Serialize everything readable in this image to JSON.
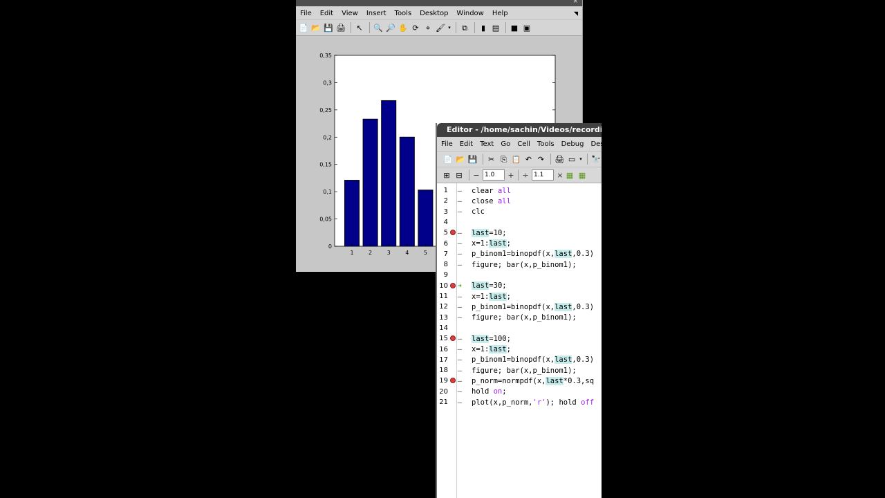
{
  "figure": {
    "menu": [
      "File",
      "Edit",
      "View",
      "Insert",
      "Tools",
      "Desktop",
      "Window",
      "Help"
    ],
    "toolbar_icons": [
      "new-file-icon",
      "open-folder-icon",
      "save-icon",
      "print-icon",
      "pointer-icon",
      "zoom-in-icon",
      "zoom-out-icon",
      "pan-hand-icon",
      "rotate-3d-icon",
      "data-cursor-icon",
      "brush-icon",
      "link-plot-icon",
      "colorbar-icon",
      "legend-icon",
      "hide-plot-tools-icon",
      "show-plot-tools-icon"
    ],
    "chart_data": {
      "type": "bar",
      "categories": [
        "1",
        "2",
        "3",
        "4",
        "5"
      ],
      "values": [
        0.121,
        0.233,
        0.267,
        0.2,
        0.103
      ],
      "ylim": [
        0,
        0.35
      ],
      "yticks": [
        "0",
        "0,05",
        "0,1",
        "0,15",
        "0,2",
        "0,25",
        "0,3",
        "0,35"
      ],
      "bar_color": "#00008b"
    }
  },
  "editor": {
    "title": "Editor - /home/sachin/Videos/recordi",
    "menu": [
      "File",
      "Edit",
      "Text",
      "Go",
      "Cell",
      "Tools",
      "Debug",
      "Desk"
    ],
    "spacing_value": "1.0",
    "scale_value": "1.1",
    "lines": [
      {
        "n": "1",
        "bp": false,
        "arrow": false,
        "tokens": [
          {
            "t": "clear "
          },
          {
            "t": "all",
            "c": "kw"
          }
        ]
      },
      {
        "n": "2",
        "bp": false,
        "arrow": false,
        "tokens": [
          {
            "t": "close "
          },
          {
            "t": "all",
            "c": "kw"
          }
        ]
      },
      {
        "n": "3",
        "bp": false,
        "arrow": false,
        "tokens": [
          {
            "t": "clc"
          }
        ]
      },
      {
        "n": "4",
        "bp": false,
        "arrow": false,
        "tokens": []
      },
      {
        "n": "5",
        "bp": true,
        "arrow": false,
        "tokens": [
          {
            "t": "last",
            "c": "hl"
          },
          {
            "t": "=10;"
          }
        ]
      },
      {
        "n": "6",
        "bp": false,
        "arrow": false,
        "tokens": [
          {
            "t": "x=1:"
          },
          {
            "t": "last",
            "c": "hl"
          },
          {
            "t": ";"
          }
        ]
      },
      {
        "n": "7",
        "bp": false,
        "arrow": false,
        "tokens": [
          {
            "t": "p_binom1=binopdf(x,"
          },
          {
            "t": "last",
            "c": "hl"
          },
          {
            "t": ",0.3)"
          }
        ]
      },
      {
        "n": "8",
        "bp": false,
        "arrow": false,
        "tokens": [
          {
            "t": "figure; bar(x,p_binom1);"
          }
        ]
      },
      {
        "n": "9",
        "bp": false,
        "arrow": false,
        "tokens": []
      },
      {
        "n": "10",
        "bp": true,
        "arrow": true,
        "tokens": [
          {
            "t": "last",
            "c": "hl"
          },
          {
            "t": "=30;"
          }
        ]
      },
      {
        "n": "11",
        "bp": false,
        "arrow": false,
        "tokens": [
          {
            "t": "x=1:"
          },
          {
            "t": "last",
            "c": "hl"
          },
          {
            "t": ";"
          }
        ]
      },
      {
        "n": "12",
        "bp": false,
        "arrow": false,
        "tokens": [
          {
            "t": "p_binom1=binopdf(x,"
          },
          {
            "t": "last",
            "c": "hl"
          },
          {
            "t": ",0.3)"
          }
        ]
      },
      {
        "n": "13",
        "bp": false,
        "arrow": false,
        "tokens": [
          {
            "t": "figure; bar(x,p_binom1);"
          }
        ]
      },
      {
        "n": "14",
        "bp": false,
        "arrow": false,
        "tokens": []
      },
      {
        "n": "15",
        "bp": true,
        "arrow": false,
        "tokens": [
          {
            "t": "last",
            "c": "hl"
          },
          {
            "t": "=100;"
          }
        ]
      },
      {
        "n": "16",
        "bp": false,
        "arrow": false,
        "tokens": [
          {
            "t": "x=1:"
          },
          {
            "t": "last",
            "c": "hl"
          },
          {
            "t": ";"
          }
        ]
      },
      {
        "n": "17",
        "bp": false,
        "arrow": false,
        "tokens": [
          {
            "t": "p_binom1=binopdf(x,"
          },
          {
            "t": "last",
            "c": "hl"
          },
          {
            "t": ",0.3)"
          }
        ]
      },
      {
        "n": "18",
        "bp": false,
        "arrow": false,
        "tokens": [
          {
            "t": "figure; bar(x,p_binom1);"
          }
        ]
      },
      {
        "n": "19",
        "bp": true,
        "arrow": false,
        "tokens": [
          {
            "t": "p_norm=normpdf(x,"
          },
          {
            "t": "last",
            "c": "hl"
          },
          {
            "t": "*0.3,sq"
          }
        ]
      },
      {
        "n": "20",
        "bp": false,
        "arrow": false,
        "tokens": [
          {
            "t": "hold "
          },
          {
            "t": "on",
            "c": "kw"
          },
          {
            "t": ";"
          }
        ]
      },
      {
        "n": "21",
        "bp": false,
        "arrow": false,
        "tokens": [
          {
            "t": "plot(x,p_norm,"
          },
          {
            "t": "'r'",
            "c": "str"
          },
          {
            "t": "); hold "
          },
          {
            "t": "off",
            "c": "kw"
          }
        ]
      }
    ]
  }
}
